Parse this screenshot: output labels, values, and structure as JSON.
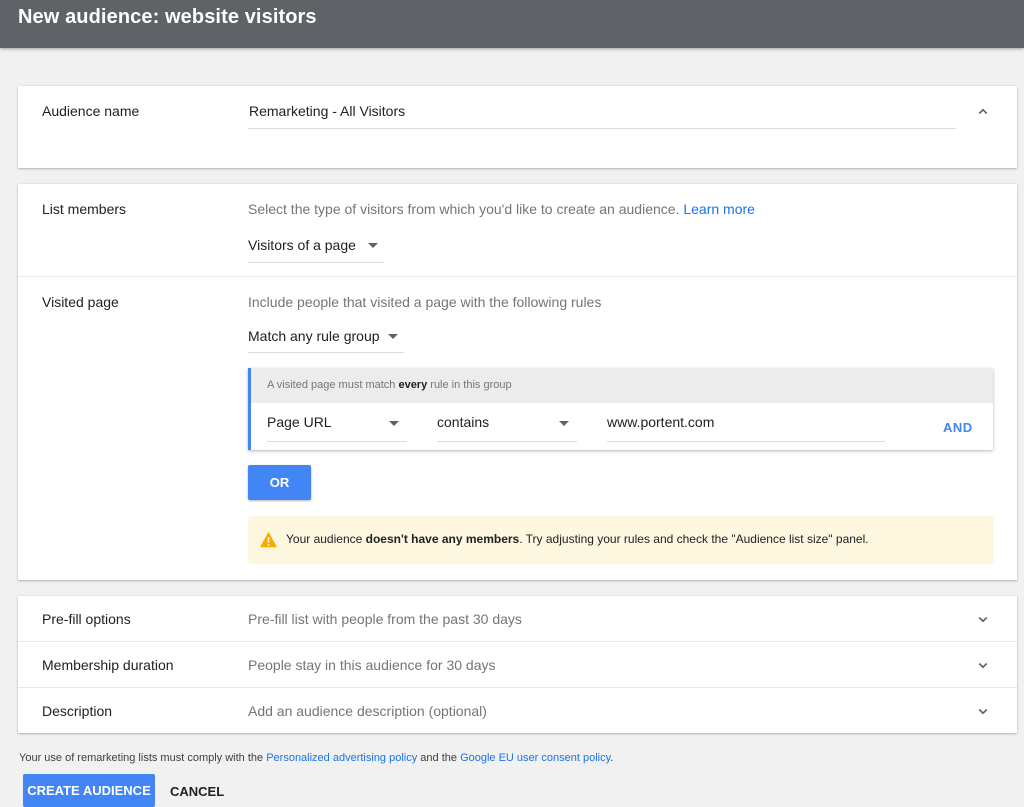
{
  "header": {
    "title": "New audience: website visitors"
  },
  "audience_name": {
    "label": "Audience name",
    "value": "Remarketing - All Visitors"
  },
  "list_members": {
    "label": "List members",
    "hint": "Select the type of visitors from which you'd like to create an audience.",
    "learn_more": "Learn more",
    "selected": "Visitors of a page"
  },
  "visited_page": {
    "label": "Visited page",
    "hint": "Include people that visited a page with the following rules",
    "match_selected": "Match any rule group",
    "rule_group": {
      "header_pre": "A visited page must match ",
      "header_bold": "every",
      "header_post": " rule in this group",
      "field": "Page URL",
      "operator": "contains",
      "value": "www.portent.com",
      "and_label": "AND"
    },
    "or_label": "OR",
    "warning": {
      "pre": "Your audience ",
      "bold": "doesn't have any members",
      "post": ". Try adjusting your rules and check the \"Audience list size\" panel."
    }
  },
  "prefill": {
    "label": "Pre-fill options",
    "value": "Pre-fill list with people from the past 30 days"
  },
  "membership": {
    "label": "Membership duration",
    "value": "People stay in this audience for 30 days"
  },
  "description": {
    "label": "Description",
    "placeholder": "Add an audience description (optional)"
  },
  "footer": {
    "policy_pre": "Your use of remarketing lists must comply with the ",
    "policy_link1": "Personalized advertising policy",
    "policy_mid": " and the ",
    "policy_link2": "Google EU user consent policy",
    "policy_post": ".",
    "create_label": "CREATE AUDIENCE",
    "cancel_label": "CANCEL"
  },
  "colors": {
    "accent": "#4285f4",
    "link": "#1a73e8",
    "warning_bg": "#fef7e0",
    "warning_icon": "#f9ab00",
    "topbar": "#5f6368"
  }
}
